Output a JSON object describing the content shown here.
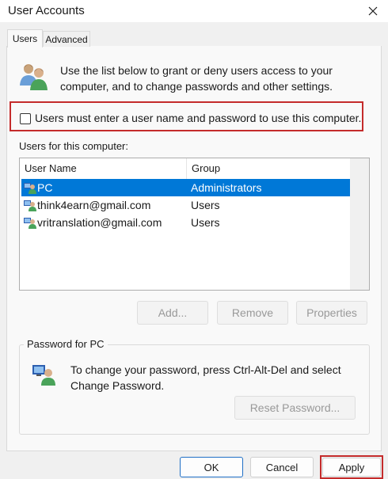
{
  "window": {
    "title": "User Accounts"
  },
  "tabs": [
    {
      "label": "Users",
      "active": true
    },
    {
      "label": "Advanced",
      "active": false
    }
  ],
  "intro": {
    "text": "Use the list below to grant or deny users access to your computer, and to change passwords and other settings."
  },
  "require_login": {
    "label": "Users must enter a user name and password to use this computer.",
    "checked": false
  },
  "users_section": {
    "label": "Users for this computer:",
    "columns": [
      "User Name",
      "Group"
    ],
    "rows": [
      {
        "name": "PC",
        "group": "Administrators",
        "selected": true
      },
      {
        "name": "think4earn@gmail.com",
        "group": "Users",
        "selected": false
      },
      {
        "name": "vritranslation@gmail.com",
        "group": "Users",
        "selected": false
      }
    ]
  },
  "user_buttons": {
    "add": "Add...",
    "remove": "Remove",
    "properties": "Properties"
  },
  "password_section": {
    "title": "Password for PC",
    "text": "To change your password, press Ctrl-Alt-Del and select Change Password.",
    "reset_button": "Reset Password..."
  },
  "footer": {
    "ok": "OK",
    "cancel": "Cancel",
    "apply": "Apply"
  },
  "colors": {
    "selection": "#0078d7",
    "highlight_border": "#c42b2b",
    "default_button_border": "#1f6fc6"
  }
}
